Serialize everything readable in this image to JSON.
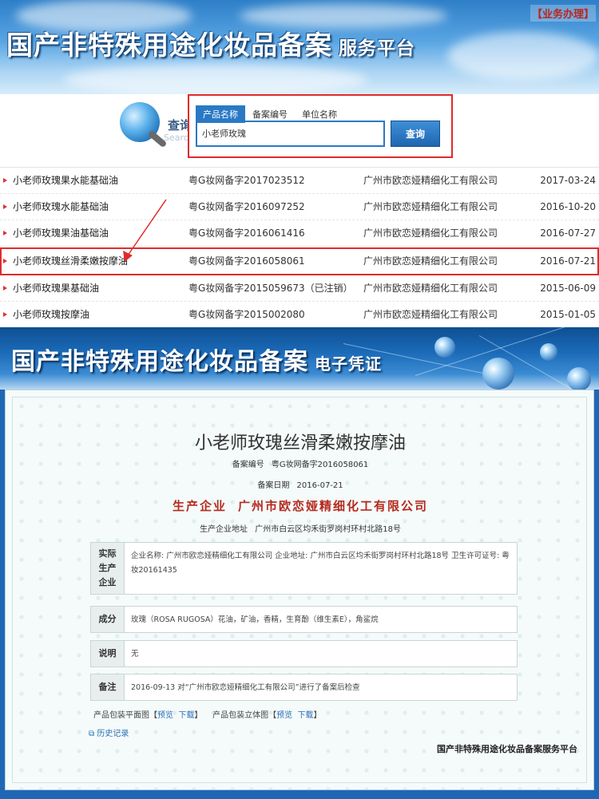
{
  "header1": {
    "title": "国产非特殊用途化妆品备案",
    "subtitle": "服务平台",
    "biz_link": "【业务办理】"
  },
  "search": {
    "label": "查询",
    "label_en": "Search",
    "tabs": [
      "产品名称",
      "备案编号",
      "单位名称"
    ],
    "active_tab": "产品名称",
    "input_value": "小老师玫瑰",
    "button_label": "查询"
  },
  "results": [
    {
      "name": "小老师玫瑰果水能基础油",
      "code": "粤G妆网备字2017023512",
      "corp": "广州市欧恋娅精细化工有限公司",
      "date": "2017-03-24"
    },
    {
      "name": "小老师玫瑰水能基础油",
      "code": "粤G妆网备字2016097252",
      "corp": "广州市欧恋娅精细化工有限公司",
      "date": "2016-10-20"
    },
    {
      "name": "小老师玫瑰果油基础油",
      "code": "粤G妆网备字2016061416",
      "corp": "广州市欧恋娅精细化工有限公司",
      "date": "2016-07-27"
    },
    {
      "name": "小老师玫瑰丝滑柔嫩按摩油",
      "code": "粤G妆网备字2016058061",
      "corp": "广州市欧恋娅精细化工有限公司",
      "date": "2016-07-21"
    },
    {
      "name": "小老师玫瑰果基础油",
      "code": "粤G妆网备字2015059673（已注销）",
      "corp": "广州市欧恋娅精细化工有限公司",
      "date": "2015-06-09"
    },
    {
      "name": "小老师玫瑰按摩油",
      "code": "粤G妆网备字2015002080",
      "corp": "广州市欧恋娅精细化工有限公司",
      "date": "2015-01-05"
    }
  ],
  "header2": {
    "title": "国产非特殊用途化妆品备案",
    "subtitle": "电子凭证"
  },
  "certificate": {
    "product_name": "小老师玫瑰丝滑柔嫩按摩油",
    "reg_no_label": "备案编号",
    "reg_no": "粤G妆网备字2016058061",
    "date_label": "备案日期",
    "date": "2016-07-21",
    "producer_label": "生产企业",
    "producer": "广州市欧恋娅精细化工有限公司",
    "address_label": "生产企业地址",
    "address": "广州市白云区均禾街罗岗村环村北路18号",
    "actual_label": "实际生产企业",
    "actual_value": "企业名称: 广州市欧恋娅精细化工有限公司    企业地址: 广州市白云区均禾街罗岗村环村北路18号    卫生许可证号: 粤妆20161435",
    "ingredients_label": "成分",
    "ingredients": "玫瑰（ROSA RUGOSA）花油，矿油，香精，生育酚（维生素E），角鲨烷",
    "note_label": "说明",
    "note": "无",
    "remark_label": "备注",
    "remark": "2016-09-13 对“广州市欧恋娅精细化工有限公司”进行了备案后检查",
    "pkg_flat_label": "产品包装平面图【",
    "pkg_3d_label": "产品包装立体图【",
    "preview": "预览",
    "download": "下载",
    "close_bracket": "】",
    "history": "历史记录",
    "footer_brand": "国产非特殊用途化妆品备案服务平台"
  },
  "colors": {
    "highlight_red": "#e02b2b",
    "accent_blue": "#2a79c5",
    "corp_red": "#b52a1e"
  }
}
